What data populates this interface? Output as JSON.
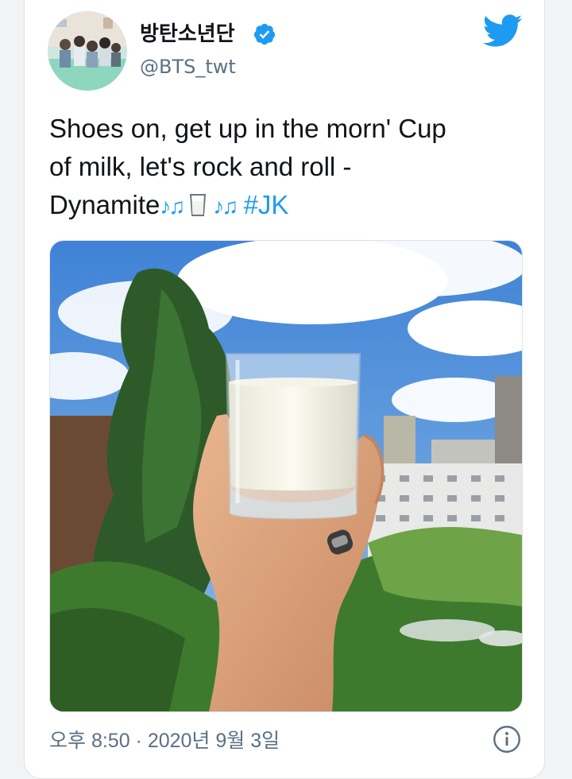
{
  "tweet": {
    "display_name": "방탄소년단",
    "handle": "@BTS_twt",
    "text_line1": "Shoes on, get up in the morn' Cup",
    "text_line2": "of milk, let's rock and roll -",
    "text_line3_prefix": "Dynamite",
    "notes_emoji": "♪♫",
    "hashtag": "#JK",
    "timestamp": "오후 8:50 · 2020년 9월 3일"
  },
  "colors": {
    "accent": "#1d9bf0",
    "text": "#0f1419",
    "secondary": "#5b7083"
  },
  "icons": {
    "verified": "verified-badge-icon",
    "brand": "twitter-bird-icon",
    "info": "info-icon"
  }
}
